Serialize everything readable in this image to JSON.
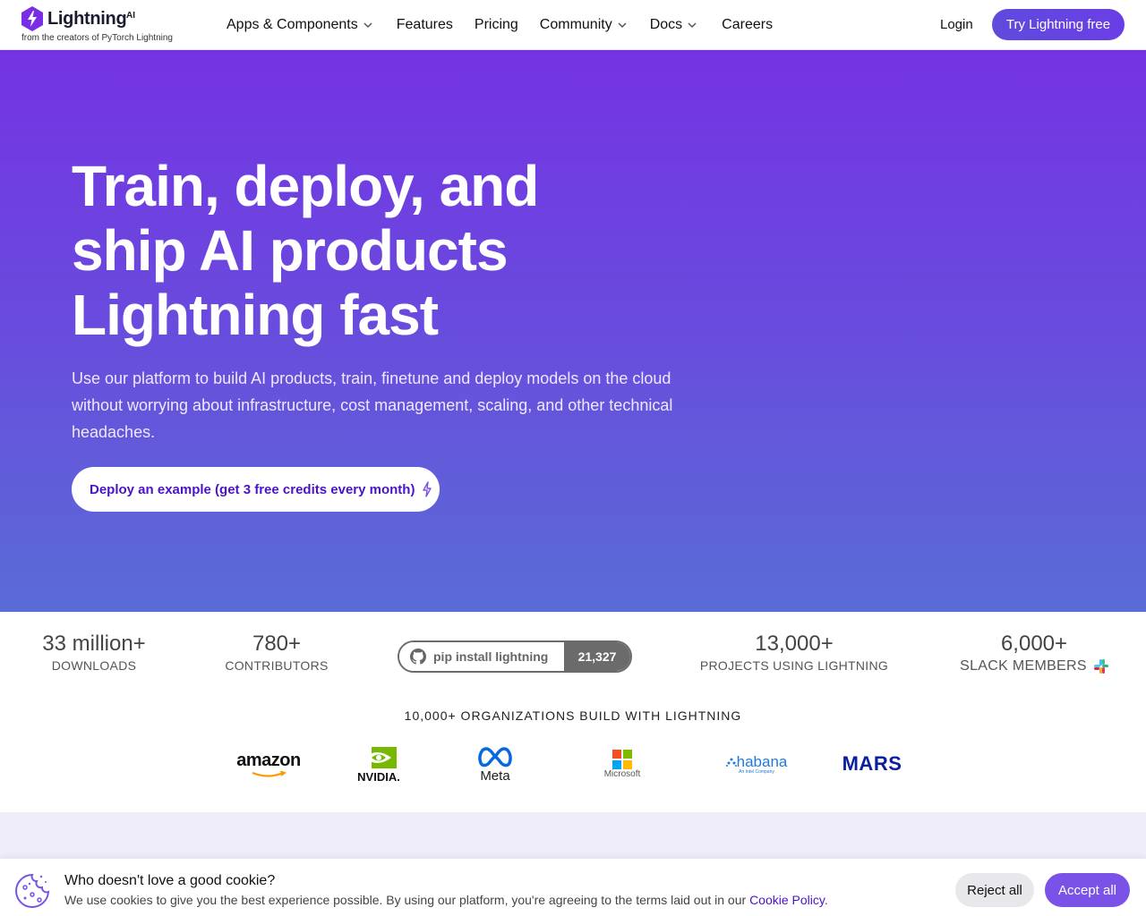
{
  "header": {
    "logo_name": "Lightning",
    "logo_ai": "AI",
    "logo_tagline": "from the creators of PyTorch Lightning",
    "nav": [
      {
        "label": "Apps & Components",
        "has_dropdown": true
      },
      {
        "label": "Features",
        "has_dropdown": false
      },
      {
        "label": "Pricing",
        "has_dropdown": false
      },
      {
        "label": "Community",
        "has_dropdown": true
      },
      {
        "label": "Docs",
        "has_dropdown": true
      },
      {
        "label": "Careers",
        "has_dropdown": false
      }
    ],
    "login_label": "Login",
    "try_label": "Try Lightning free",
    "accent_color": "#6640e0"
  },
  "hero": {
    "title_lines": [
      "Train, deploy, and",
      "ship AI products",
      "Lightning fast"
    ],
    "subtitle": "Use our platform to build AI products, train, finetune and deploy models on the cloud without worrying about infrastructure, cost management, scaling, and other technical headaches.",
    "cta_label": "Deploy an example (get 3 free credits every month)",
    "gradient_top": "#7433e3",
    "gradient_bottom": "#5a6cd6"
  },
  "stats": {
    "downloads": {
      "value": "33 million+",
      "label": "DOWNLOADS"
    },
    "contributors": {
      "value": "780+",
      "label": "CONTRIBUTORS"
    },
    "pip": {
      "command": "pip install lightning",
      "stars": "21,327"
    },
    "projects": {
      "value": "13,000+",
      "label": "PROJECTS USING LIGHTNING"
    },
    "slack": {
      "value": "6,000+",
      "label": "SLACK MEMBERS"
    }
  },
  "organizations": {
    "title": "10,000+ ORGANIZATIONS BUILD WITH LIGHTNING",
    "logos": {
      "amazon": "amazon",
      "nvidia": "NVIDIA.",
      "meta": "Meta",
      "microsoft": "Microsoft",
      "habana": "habana",
      "habana_sub": "An Intel Company",
      "mars": "MARS"
    }
  },
  "cookie": {
    "title": "Who doesn't love a good cookie?",
    "text": "We use cookies to give you the best experience possible. By using our platform, you're agreeing to the terms laid out in our ",
    "link": "Cookie Policy",
    "text_end": ".",
    "reject_label": "Reject all",
    "accept_label": "Accept all"
  }
}
